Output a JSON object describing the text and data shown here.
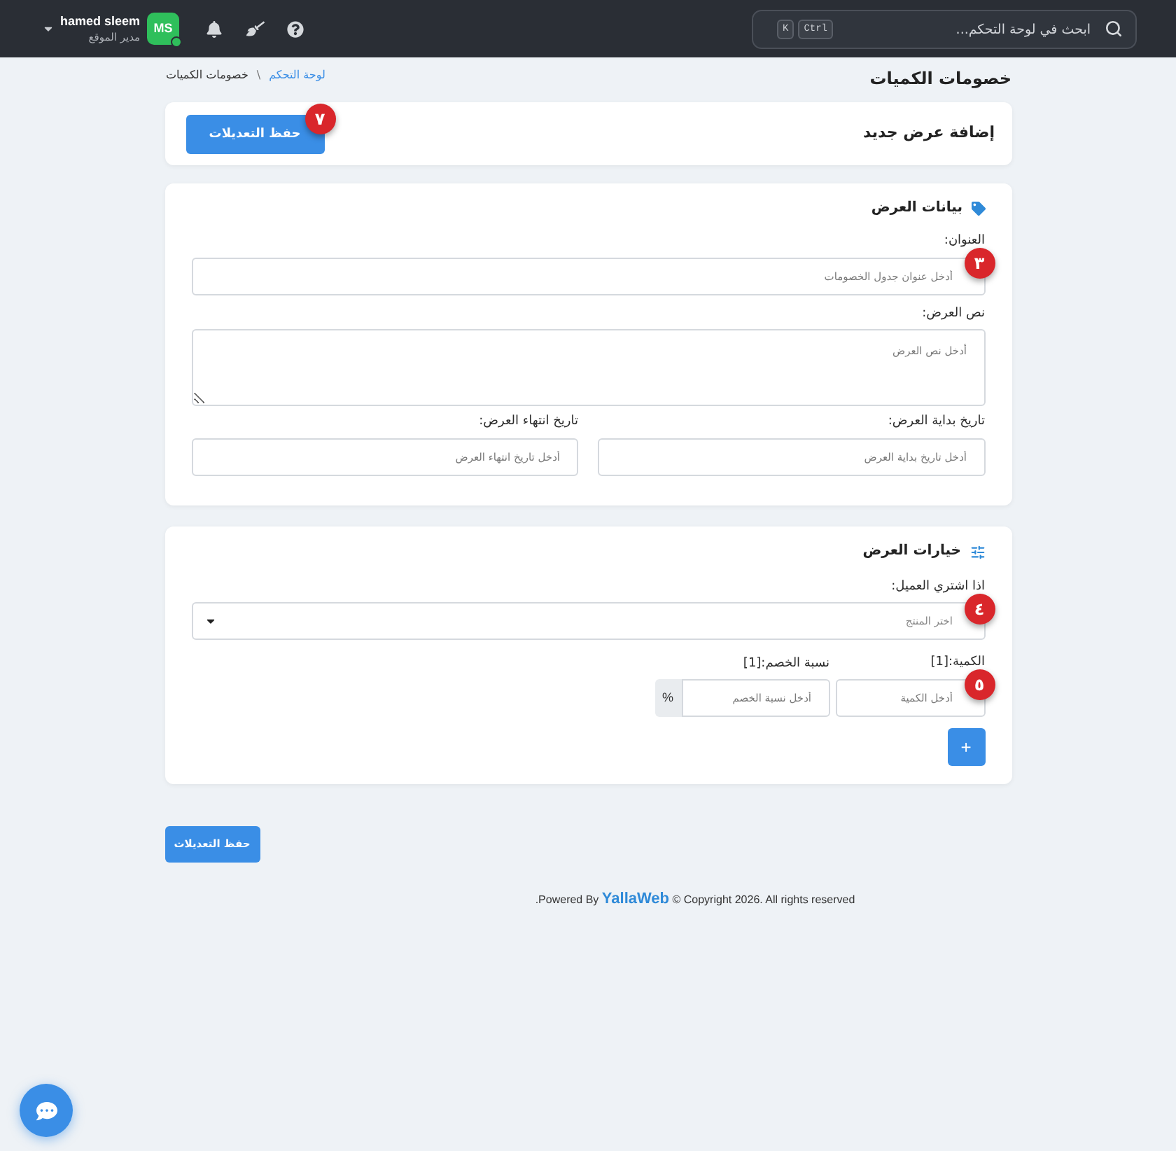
{
  "topbar": {
    "search": {
      "placeholder": "ابحث في لوحة التحكم...",
      "keys": [
        "Ctrl",
        "K"
      ]
    },
    "user": {
      "name": "hamed sleem",
      "role": "مدير الموقع",
      "initials": "MS",
      "online": true
    }
  },
  "page": {
    "title": "خصومات الكميات",
    "breadcrumb": {
      "separator": "\\",
      "items": [
        {
          "label": "لوحة التحكم",
          "link": true
        },
        {
          "label": "خصومات الكميات",
          "link": false
        }
      ]
    }
  },
  "action_card": {
    "title": "إضافة عرض جديد",
    "button": {
      "label": "حفظ التعديلات",
      "badge": "٧"
    }
  },
  "offer_data": {
    "title": "بيانات العرض",
    "fields": [
      {
        "kind": "text",
        "label": "العنوان:",
        "placeholder": "أدخل عنوان جدول الخصومات",
        "badge": "٣"
      },
      {
        "kind": "textarea",
        "label": "نص العرض:",
        "placeholder": "أدخل نص العرض"
      }
    ],
    "date_fields": [
      {
        "label": "تاريخ بداية العرض:",
        "placeholder": "أدخل تاريخ بداية العرض"
      },
      {
        "label": "تاريخ انتهاء العرض:",
        "placeholder": "أدخل تاريخ انتهاء العرض"
      }
    ]
  },
  "offer_options": {
    "title": "خيارات العرض",
    "product": {
      "label": "اذا اشتري العميل:",
      "placeholder": "اختر المنتج",
      "badge": "٤"
    },
    "tiers": [
      {
        "quantity": {
          "label": "الكمية:[1]",
          "placeholder": "أدخل الكمية",
          "badge": "٥"
        },
        "discount": {
          "label": "نسبة الخصم:[1]",
          "placeholder": "أدخل نسبة الخصم",
          "suffix": "%"
        }
      }
    ],
    "add_button": {
      "label": "+"
    }
  },
  "save_button": {
    "label": "حفظ التعديلات"
  },
  "footer": {
    "before": ".Powered By",
    "link": "YallaWeb",
    "after": "© Copyright 2026. All rights reserved"
  }
}
